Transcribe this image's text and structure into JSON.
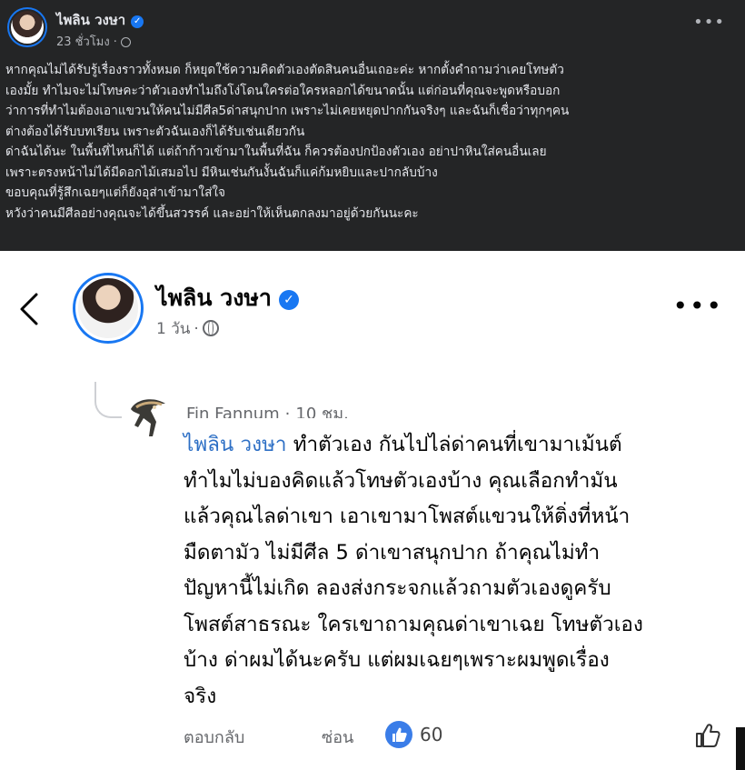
{
  "top_post": {
    "author": "ไพลิน วงษา",
    "time": "23 ชั่วโมง",
    "lines": [
      "หากคุณไม่ได้รับรู้เรื่องราวทั้งหมด ก็หยุดใช้ความคิดตัวเองตัดสินคนอื่นเถอะค่ะ หากตั้งคำถามว่าเคยโทษตัว",
      "เองมั้ย ทำไมจะไม่โทษคะว่าตัวเองทำไมถึงโง่โดนใครต่อใครหลอกได้ขนาดนั้น แต่ก่อนที่คุณจะพูดหรือบอก",
      "ว่าการที่ทำไมต้องเอาแขวนให้คนไม่มีศีล5ด่าสนุกปาก เพราะไม่เคยหยุดปากกันจริงๆ และฉันก็เชื่อว่าทุกๆคน",
      "ต่างต้องได้รับบทเรียน เพราะตัวฉันเองก็ได้รับเช่นเดียวกัน",
      "ด่าฉันได้นะ ในพื้นที่ไหนก็ได้ แต่ถ้าก้าวเข้ามาในพื้นที่ฉัน ก็ควรต้องปกป้องตัวเอง อย่าปาหินใส่คนอื่นเลย",
      "เพราะตรงหน้าไม่ได้มีดอกไม้เสมอไป มีหินเช่นกันงั้นฉันก็แค่ก้มหยิบและปากลับบ้าง",
      "ขอบคุณที่รู้สึกเฉยๆแต่ก็ยังอุส่าเข้ามาใส่ใจ",
      "หวังว่าคนมีศีลอย่างคุณจะได้ขึ้นสวรรค์ และอย่าให้เห็นตกลงมาอยู่ด้วยกันนะคะ"
    ]
  },
  "card": {
    "author": "ไพลิน วงษา",
    "time": "1 วัน"
  },
  "comment": {
    "commenter": "Fin Fannum",
    "time": "10 ชม.",
    "mention": "ไพลิน วงษา",
    "first_line_rest": " ทำตัวเอง กันไปไล่ด่าคนที่เขามาเม้นต์",
    "lines": [
      "ทำไมไม่บองคิดแล้วโทษตัวเองบ้าง คุณเลือกทำมัน",
      "แล้วคุณไลด่าเขา เอาเขามาโพสต์แขวนให้ติ่งที่หน้า",
      "มืดตามัว ไม่มีศีล 5 ด่าเขาสนุกปาก  ถ้าคุณไม่ทำ",
      "ปัญหานี้ไม่เกิด  ลองส่งกระจกแล้วถามตัวเองดูครับ",
      "โพสต์สาธรณะ ใครเขาถามคุณด่าเขาเฉย โทษตัวเอง",
      "บ้าง  ด่าผมได้นะครับ  แต่ผมเฉยๆเพราะผมพูดเรื่อง",
      "จริง"
    ],
    "reply_label": "ตอบกลับ",
    "hide_label": "ซ่อน",
    "like_count": "60"
  },
  "icons": {
    "verified": "verified-badge-icon",
    "globe": "globe-icon",
    "back": "chevron-left-icon",
    "more": "more-dots-icon",
    "like": "thumbs-up-icon"
  },
  "colors": {
    "dark_bg": "#242526",
    "facebook_blue": "#1877f2",
    "mention_blue": "#2d6fc5"
  }
}
